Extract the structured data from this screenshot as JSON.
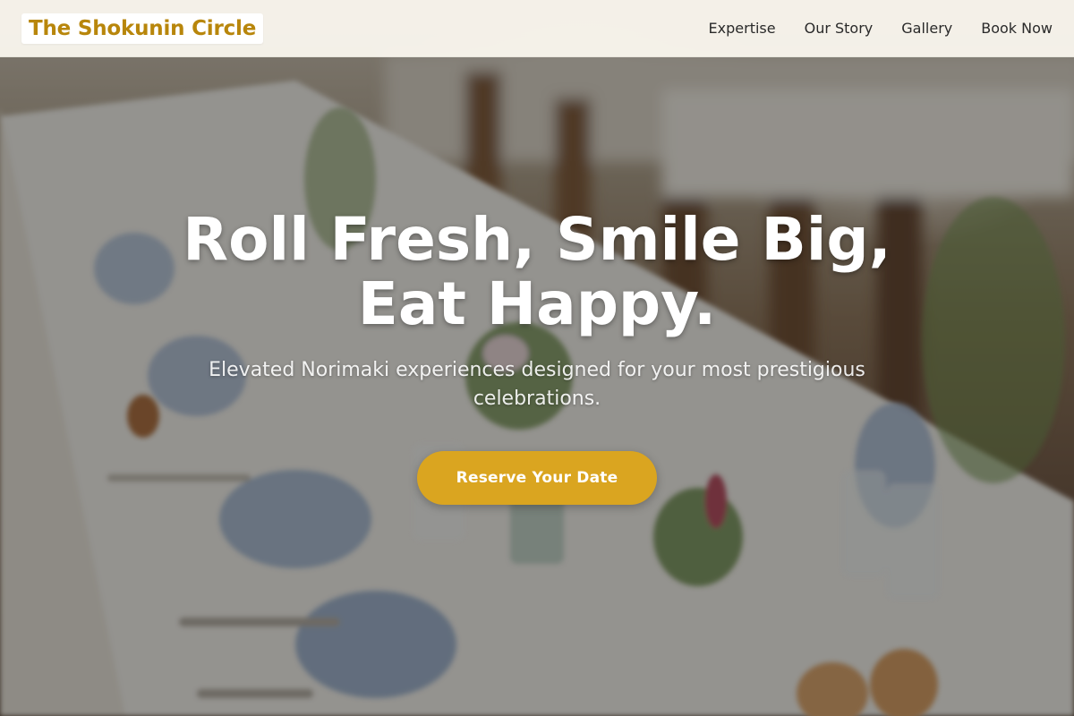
{
  "brand": {
    "name": "The Shokunin Circle",
    "color": "#b8860b"
  },
  "nav": {
    "items": [
      {
        "label": "Expertise"
      },
      {
        "label": "Our Story"
      },
      {
        "label": "Gallery"
      },
      {
        "label": "Book Now"
      }
    ]
  },
  "hero": {
    "title": "Roll Fresh, Smile Big, Eat Happy.",
    "subtitle": "Elevated Norimaki experiences designed for your most prestigious celebrations.",
    "cta_label": "Reserve Your Date",
    "cta_color": "#daa520"
  }
}
